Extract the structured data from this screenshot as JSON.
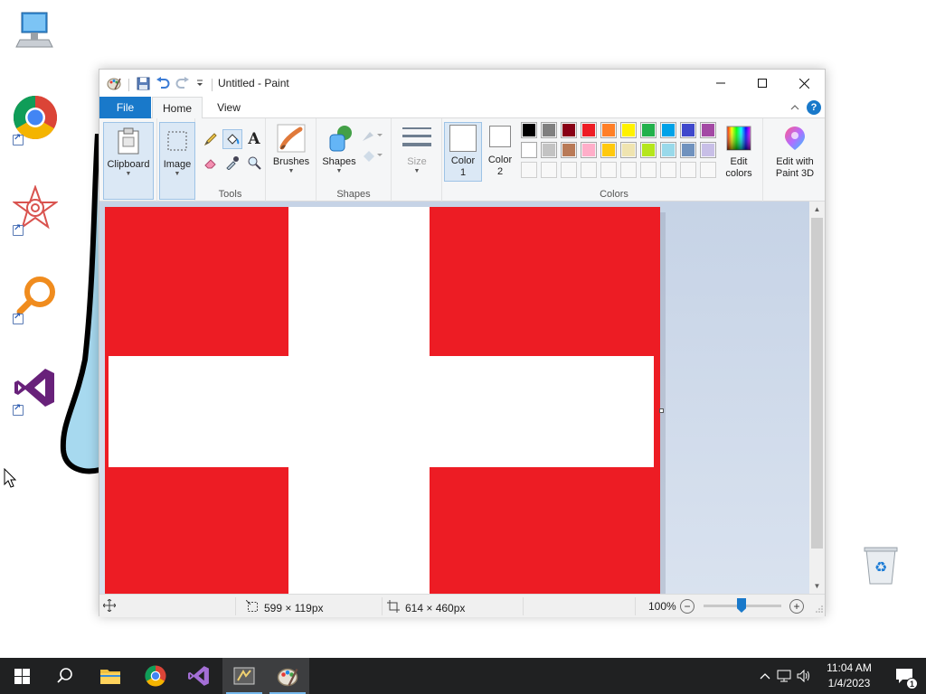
{
  "desktop": {
    "icons": [
      {
        "name": "this-pc"
      },
      {
        "name": "google-chrome"
      },
      {
        "name": "app-shortcut"
      },
      {
        "name": "search-app"
      },
      {
        "name": "visual-studio"
      },
      {
        "name": "recycle-bin"
      }
    ]
  },
  "paint": {
    "title": "Untitled - Paint",
    "tabs": {
      "file": "File",
      "home": "Home",
      "view": "View"
    },
    "groups": {
      "clipboard": "Clipboard",
      "image": "Image",
      "tools": "Tools",
      "brushes": "Brushes",
      "shapes_btn": "Shapes",
      "shapes_group": "Shapes",
      "size": "Size",
      "color1": "Color\n1",
      "color1_line1": "Color",
      "color1_line2": "1",
      "color2_line1": "Color",
      "color2_line2": "2",
      "colors": "Colors",
      "edit_colors_line1": "Edit",
      "edit_colors_line2": "colors",
      "paint3d_line1": "Edit with",
      "paint3d_line2": "Paint 3D"
    },
    "palette_row1": [
      "#000000",
      "#7f7f7f",
      "#880015",
      "#ed1c24",
      "#ff7f27",
      "#fff200",
      "#22b14c",
      "#00a2e8",
      "#3f48cc",
      "#a349a4"
    ],
    "palette_row2": [
      "#ffffff",
      "#c3c3c3",
      "#b97a57",
      "#ffaec9",
      "#ffc90e",
      "#efe4b0",
      "#b5e61d",
      "#99d9ea",
      "#7092be",
      "#c8bfe7"
    ],
    "color1_value": "#ffffff",
    "color2_value": "#ffffff",
    "flag_colors": {
      "red": "#ed1c24",
      "white": "#ffffff"
    },
    "status": {
      "selection_size": "599 × 119px",
      "image_size": "614 × 460px",
      "zoom": "100%"
    }
  },
  "taskbar": {
    "time": "11:04 AM",
    "date": "1/4/2023",
    "notification_count": "1"
  }
}
